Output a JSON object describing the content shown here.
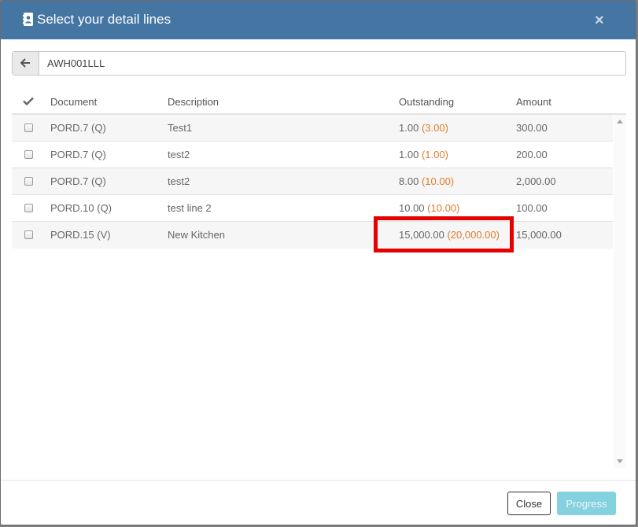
{
  "dialog": {
    "title": "Select your detail lines",
    "title_icon": "contact-book-icon",
    "close_icon": "close-icon",
    "close_glyph": "×"
  },
  "search": {
    "value": "AWH001LLL",
    "back_icon": "arrow-left-icon"
  },
  "table": {
    "columns": {
      "select_icon": "checkmark-icon",
      "document": "Document",
      "description": "Description",
      "outstanding": "Outstanding",
      "amount": "Amount"
    },
    "rows": [
      {
        "document": "PORD.7 (Q)",
        "description": "Test1",
        "outstanding": "1.00",
        "original": "(3.00)",
        "amount": "300.00"
      },
      {
        "document": "PORD.7 (Q)",
        "description": "test2",
        "outstanding": "1.00",
        "original": "(1.00)",
        "amount": "200.00"
      },
      {
        "document": "PORD.7 (Q)",
        "description": "test2",
        "outstanding": "8.00",
        "original": "(10.00)",
        "amount": "2,000.00"
      },
      {
        "document": "PORD.10 (Q)",
        "description": "test line 2",
        "outstanding": "10.00",
        "original": "(10.00)",
        "amount": "100.00"
      },
      {
        "document": "PORD.15 (V)",
        "description": "New Kitchen",
        "outstanding": "15,000.00",
        "original": "(20,000.00)",
        "amount": "15,000.00"
      }
    ]
  },
  "footer": {
    "close_label": "Close",
    "progress_label": "Progress"
  },
  "colors": {
    "header_bg": "#4575a3",
    "original_amount": "#e07b2a",
    "highlight": "#e60000",
    "progress_button": "#84d1e0"
  }
}
